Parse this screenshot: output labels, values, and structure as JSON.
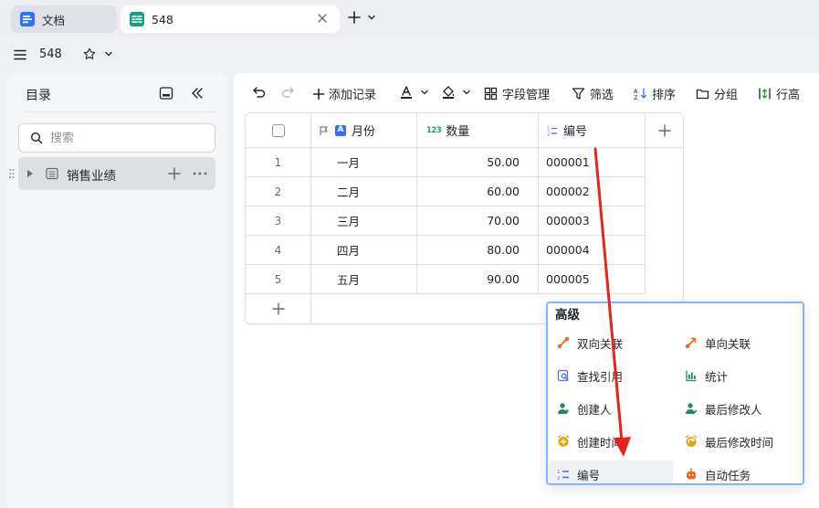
{
  "tabs": [
    {
      "label": "文档"
    },
    {
      "label": "548"
    }
  ],
  "doc": {
    "title": "548"
  },
  "sidebar": {
    "title": "目录",
    "search_placeholder": "搜索",
    "items": [
      {
        "label": "销售业绩"
      }
    ]
  },
  "toolbar": {
    "add_record": "添加记录",
    "field_manage": "字段管理",
    "filter": "筛选",
    "sort": "排序",
    "group": "分组",
    "row_height": "行高"
  },
  "table": {
    "columns": [
      {
        "label": "月份",
        "type_badge": "A"
      },
      {
        "label": "数量",
        "type_badge": "123"
      },
      {
        "label": "编号"
      }
    ],
    "rows": [
      {
        "num": "1",
        "month": "一月",
        "qty": "50.00",
        "code": "000001"
      },
      {
        "num": "2",
        "month": "二月",
        "qty": "60.00",
        "code": "000002"
      },
      {
        "num": "3",
        "month": "三月",
        "qty": "70.00",
        "code": "000003"
      },
      {
        "num": "4",
        "month": "四月",
        "qty": "80.00",
        "code": "000004"
      },
      {
        "num": "5",
        "month": "五月",
        "qty": "90.00",
        "code": "000005"
      }
    ]
  },
  "field_menu": {
    "section": "高级",
    "items": [
      {
        "label": "双向关联",
        "icon": "two-way-link-icon"
      },
      {
        "label": "单向关联",
        "icon": "one-way-link-icon"
      },
      {
        "label": "查找引用",
        "icon": "lookup-icon"
      },
      {
        "label": "统计",
        "icon": "stats-icon"
      },
      {
        "label": "创建人",
        "icon": "creator-icon"
      },
      {
        "label": "最后修改人",
        "icon": "modifier-icon"
      },
      {
        "label": "创建时间",
        "icon": "created-time-icon"
      },
      {
        "label": "最后修改时间",
        "icon": "modified-time-icon"
      },
      {
        "label": "编号",
        "icon": "auto-number-icon"
      },
      {
        "label": "自动任务",
        "icon": "automation-icon"
      }
    ]
  },
  "colors": {
    "accent": "#3370ff",
    "annotation_arrow": "#e8231a",
    "link_icon": "#ee6a1e",
    "person_icon": "#1f8c5c",
    "time_icon": "#e9a20e",
    "lookup_icon": "#7b5ce8"
  }
}
